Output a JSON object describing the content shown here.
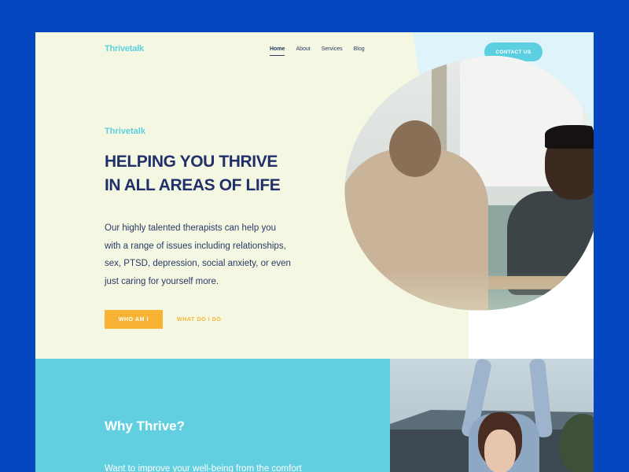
{
  "header": {
    "brand": "Thrivetalk",
    "nav": [
      "Home",
      "About",
      "Services",
      "Blog"
    ],
    "active_nav": "Home",
    "contact_label": "CONTACT US"
  },
  "hero": {
    "brand": "Thrivetalk",
    "headline_line1": "HELPING YOU THRIVE",
    "headline_line2": "IN ALL AREAS OF LIFE",
    "intro_line1": "Our highly talented therapists can help you",
    "intro_line2": "with a range of issues including relationships,",
    "intro_line3": "sex, PTSD, depression, social anxiety, or even",
    "intro_line4": "just caring for yourself more.",
    "primary_button": "WHO AM I",
    "secondary_button": "WHAT DO I DO"
  },
  "why": {
    "title": "Why Thrive?",
    "text": "Want to improve your well-being from the comfort"
  },
  "colors": {
    "page_bg": "#0447c1",
    "hero_bg": "#f4f8e2",
    "accent_cyan": "#5ccfe0",
    "accent_yellow": "#f8b335",
    "navy": "#22306a"
  }
}
